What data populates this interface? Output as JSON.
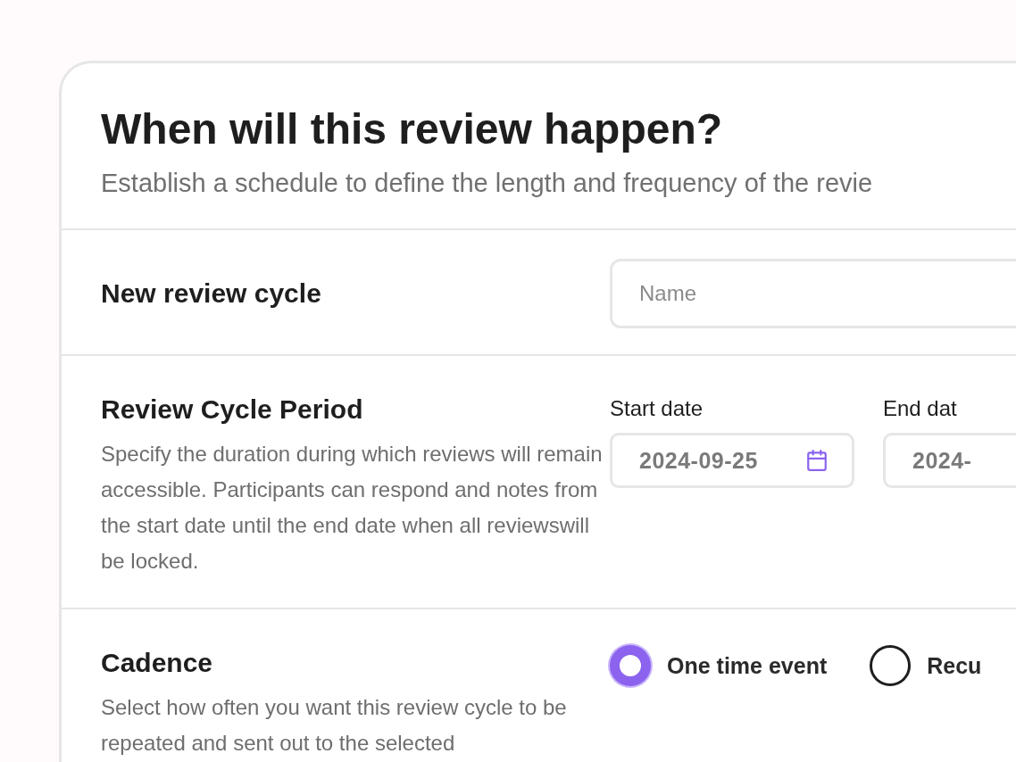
{
  "header": {
    "title": "When will this review happen?",
    "subtitle": "Establish a schedule to define the length and frequency of the revie"
  },
  "sections": [
    {
      "kind": "text_input",
      "title": "New review cycle",
      "field": {
        "placeholder": "Name"
      }
    },
    {
      "kind": "date_range",
      "title": "Review Cycle Period",
      "description": "Specify the duration during which reviews will remain accessible. Participants can respond and notes from the start date until the end date when all reviewswill be locked.",
      "dates": [
        {
          "label": "Start date",
          "value": "2024-09-25"
        },
        {
          "label": "End dat",
          "value": "2024-"
        }
      ]
    },
    {
      "kind": "radio_group",
      "title": "Cadence",
      "description": "Select how often you want this review cycle to be repeated and sent out to the selected",
      "options": [
        {
          "label": "One time event",
          "selected": true
        },
        {
          "label": "Recu",
          "selected": false
        }
      ]
    }
  ]
}
